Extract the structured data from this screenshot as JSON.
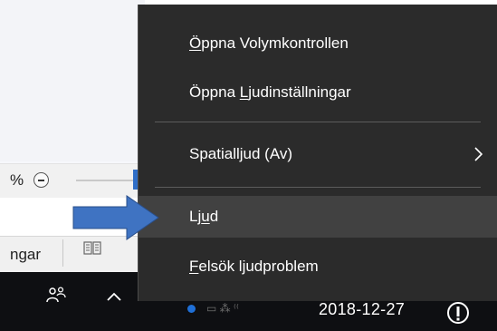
{
  "background_window": {
    "zoom_label": "%",
    "status_text": "ngar"
  },
  "menu": {
    "items": [
      {
        "pre": "",
        "accel": "Ö",
        "post": "ppna Volymkontrollen",
        "highlighted": false
      },
      {
        "pre": "Öppna ",
        "accel": "L",
        "post": "judinställningar",
        "highlighted": false
      },
      {
        "pre": "Spatialljud (Av)",
        "accel": "",
        "post": "",
        "highlighted": false,
        "has_submenu": true
      },
      {
        "pre": "Lj",
        "accel": "u",
        "post": "d",
        "highlighted": true
      },
      {
        "pre": "",
        "accel": "F",
        "post": "elsök ljudproblem",
        "highlighted": false
      }
    ]
  },
  "taskbar": {
    "date": "2018-12-27",
    "icons": [
      "people-icon",
      "chevron-up-icon",
      "action-center-icon"
    ]
  },
  "colors": {
    "menu_bg": "#2b2b2b",
    "menu_highlight": "#414141",
    "taskbar_bg": "#0e0f12",
    "arrow_fill": "#3f73c2"
  }
}
